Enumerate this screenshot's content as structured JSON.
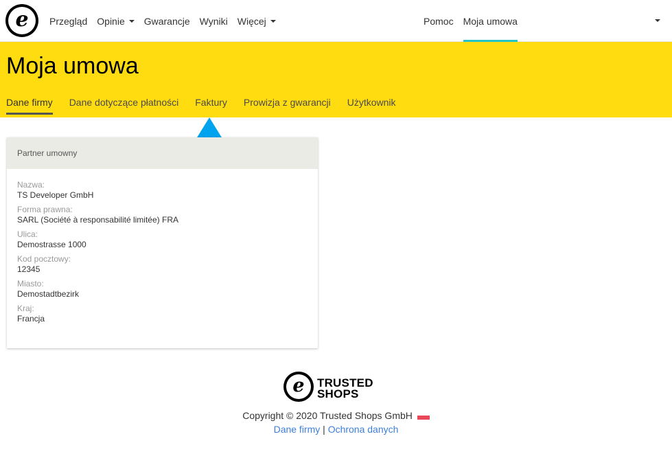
{
  "nav": {
    "logo_letter": "e",
    "left_items": [
      {
        "label": "Przegląd",
        "dropdown": false
      },
      {
        "label": "Opinie",
        "dropdown": true
      },
      {
        "label": "Gwarancje",
        "dropdown": false
      },
      {
        "label": "Wyniki",
        "dropdown": false
      },
      {
        "label": "Więcej",
        "dropdown": true
      }
    ],
    "help_label": "Pomoc",
    "contract_label": "Moja umowa"
  },
  "header": {
    "title": "Moja umowa",
    "tabs": [
      {
        "label": "Dane firmy",
        "active": true
      },
      {
        "label": "Dane dotyczące płatności",
        "active": false
      },
      {
        "label": "Faktury",
        "active": false
      },
      {
        "label": "Prowizja z gwarancji",
        "active": false
      },
      {
        "label": "Użytkownik",
        "active": false
      }
    ],
    "accent_color": "#ffdc0f",
    "nav_active_color": "#24c3c9"
  },
  "annotation": {
    "arrow_color": "#00a3ee"
  },
  "card": {
    "title": "Partner umowny",
    "fields": [
      {
        "label": "Nazwa:",
        "value": "TS Developer GmbH"
      },
      {
        "label": "Forma prawna:",
        "value": "SARL (Société à responsabilité limitée) FRA"
      },
      {
        "label": "Ulica:",
        "value": "Demostrasse 1000"
      },
      {
        "label": "Kod pocztowy:",
        "value": "12345"
      },
      {
        "label": "Miasto:",
        "value": "Demostadtbezirk"
      },
      {
        "label": "Kraj:",
        "value": "Francja"
      }
    ]
  },
  "footer": {
    "brand_line1": "TRUSTED",
    "brand_line2": "SHOPS",
    "copyright": "Copyright © 2020 Trusted Shops GmbH",
    "link_company": "Dane firmy",
    "separator": "|",
    "link_privacy": "Ochrona danych",
    "link_color": "#3d7ed8"
  }
}
